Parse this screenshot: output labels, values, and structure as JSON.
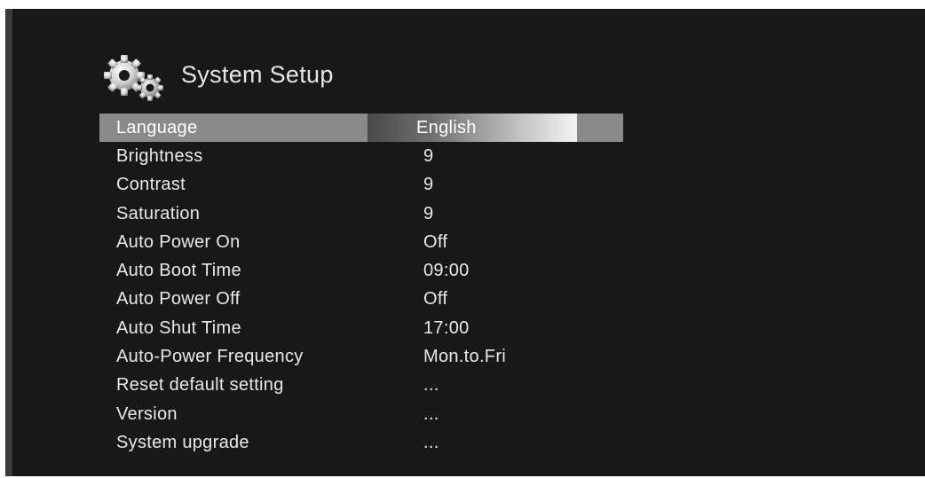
{
  "header": {
    "title": "System Setup",
    "icon": "gear-icon"
  },
  "menu": {
    "selected_index": 0,
    "items": [
      {
        "label": "Language",
        "value": "English"
      },
      {
        "label": "Brightness",
        "value": "9"
      },
      {
        "label": "Contrast",
        "value": "9"
      },
      {
        "label": "Saturation",
        "value": "9"
      },
      {
        "label": "Auto Power On",
        "value": "Off"
      },
      {
        "label": "Auto Boot Time",
        "value": "09:00"
      },
      {
        "label": "Auto Power Off",
        "value": "Off"
      },
      {
        "label": "Auto Shut Time",
        "value": "17:00"
      },
      {
        "label": "Auto-Power Frequency",
        "value": "Mon.to.Fri"
      },
      {
        "label": "Reset default setting",
        "value": "..."
      },
      {
        "label": "Version",
        "value": "..."
      },
      {
        "label": "System upgrade",
        "value": "..."
      }
    ]
  },
  "colors": {
    "background": "#181818",
    "text": "#e9e9e9",
    "highlight": "#8a8a8a"
  }
}
